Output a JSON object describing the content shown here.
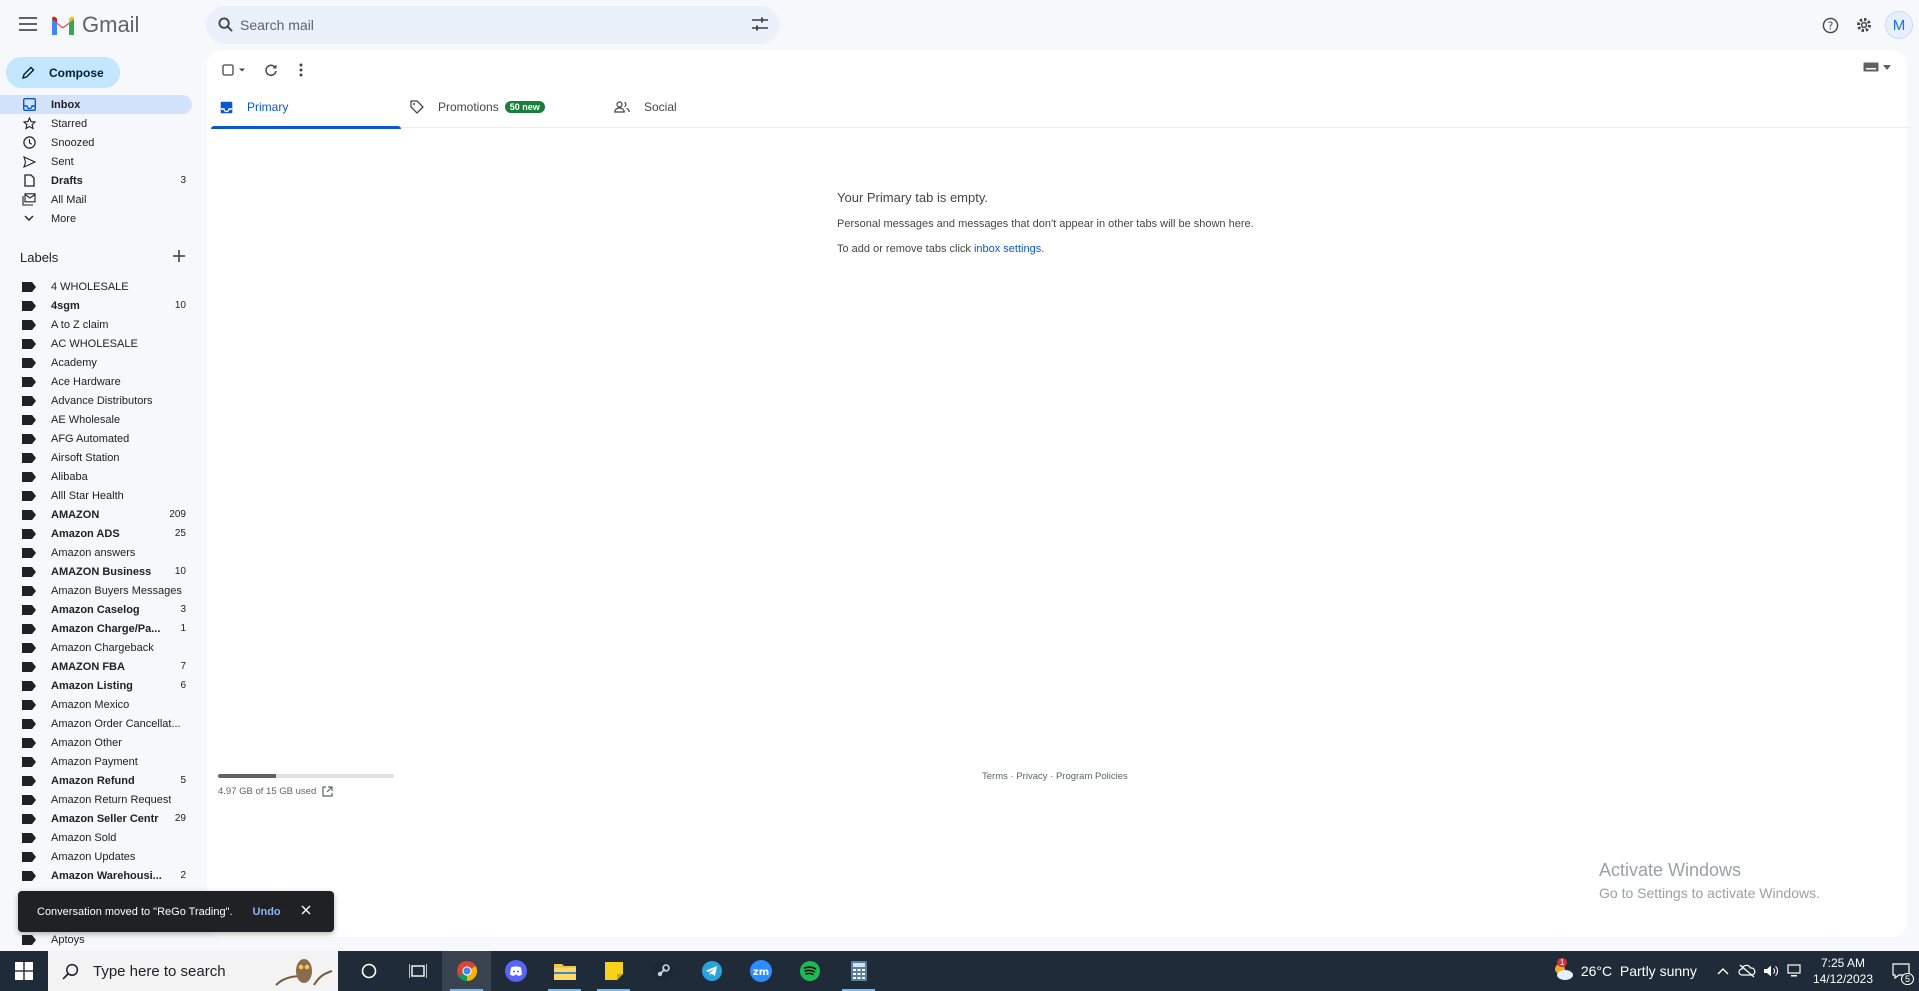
{
  "app": {
    "name": "Gmail"
  },
  "search": {
    "placeholder": "Search mail"
  },
  "header": {
    "avatar_initial": "M"
  },
  "compose_label": "Compose",
  "nav": [
    {
      "label": "Inbox",
      "icon": "inbox-icon",
      "count": "",
      "active": true,
      "bold": true
    },
    {
      "label": "Starred",
      "icon": "star-icon",
      "count": ""
    },
    {
      "label": "Snoozed",
      "icon": "clock-icon",
      "count": ""
    },
    {
      "label": "Sent",
      "icon": "send-icon",
      "count": ""
    },
    {
      "label": "Drafts",
      "icon": "draft-icon",
      "count": "3",
      "bold": true
    },
    {
      "label": "All Mail",
      "icon": "all-mail-icon",
      "count": ""
    },
    {
      "label": "More",
      "icon": "chevron-down-icon",
      "count": ""
    }
  ],
  "labels_title": "Labels",
  "labels": [
    {
      "name": "4 WHOLESALE",
      "count": ""
    },
    {
      "name": "4sgm",
      "count": "10",
      "bold": true
    },
    {
      "name": "A to Z claim",
      "count": ""
    },
    {
      "name": "AC WHOLESALE",
      "count": ""
    },
    {
      "name": "Academy",
      "count": ""
    },
    {
      "name": "Ace Hardware",
      "count": ""
    },
    {
      "name": "Advance Distributors",
      "count": ""
    },
    {
      "name": "AE Wholesale",
      "count": ""
    },
    {
      "name": "AFG Automated",
      "count": ""
    },
    {
      "name": "Airsoft Station",
      "count": ""
    },
    {
      "name": "Alibaba",
      "count": ""
    },
    {
      "name": "Alll Star Health",
      "count": ""
    },
    {
      "name": "AMAZON",
      "count": "209",
      "bold": true
    },
    {
      "name": "Amazon ADS",
      "count": "25",
      "bold": true
    },
    {
      "name": "Amazon answers",
      "count": ""
    },
    {
      "name": "AMAZON Business",
      "count": "10",
      "bold": true
    },
    {
      "name": "Amazon Buyers Messages",
      "count": ""
    },
    {
      "name": "Amazon Caselog",
      "count": "3",
      "bold": true
    },
    {
      "name": "Amazon Charge/Pa...",
      "count": "1",
      "bold": true
    },
    {
      "name": "Amazon Chargeback",
      "count": ""
    },
    {
      "name": "AMAZON FBA",
      "count": "7",
      "bold": true
    },
    {
      "name": "Amazon Listing",
      "count": "6",
      "bold": true
    },
    {
      "name": "Amazon Mexico",
      "count": ""
    },
    {
      "name": "Amazon Order Cancellat...",
      "count": ""
    },
    {
      "name": "Amazon Other",
      "count": ""
    },
    {
      "name": "Amazon Payment",
      "count": ""
    },
    {
      "name": "Amazon Refund",
      "count": "5",
      "bold": true
    },
    {
      "name": "Amazon Return Request",
      "count": ""
    },
    {
      "name": "Amazon Seller Centr",
      "count": "29",
      "bold": true
    },
    {
      "name": "Amazon Sold",
      "count": ""
    },
    {
      "name": "Amazon Updates",
      "count": ""
    },
    {
      "name": "Amazon Warehousi...",
      "count": "2",
      "bold": true
    }
  ],
  "label_tail": "Aptoys",
  "tabs": [
    {
      "label": "Primary",
      "icon": "inbox-icon",
      "active": true
    },
    {
      "label": "Promotions",
      "icon": "tag-icon",
      "badge": "50 new"
    },
    {
      "label": "Social",
      "icon": "people-icon"
    }
  ],
  "empty": {
    "title": "Your Primary tab is empty.",
    "line1": "Personal messages and messages that don't appear in other tabs will be shown here.",
    "line2_prefix": "To add or remove tabs click ",
    "line2_link": "inbox settings",
    "line2_suffix": "."
  },
  "storage": {
    "text": "4.97 GB of 15 GB used",
    "used_fraction": 0.33
  },
  "footer": {
    "terms": "Terms",
    "privacy": "Privacy",
    "policies": "Program Policies",
    "sep": " · "
  },
  "snackbar": {
    "message": "Conversation moved to \"ReGo Trading\".",
    "undo": "Undo"
  },
  "activate": {
    "title": "Activate Windows",
    "subtitle": "Go to Settings to activate Windows."
  },
  "taskbar": {
    "search_placeholder": "Type here to search",
    "weather": "26°C  Partly sunny",
    "weather_badge": "1",
    "time": "7:25 AM",
    "date": "14/12/2023",
    "notif_count": "5"
  },
  "colors": {
    "accent": "#0b57d0",
    "compose_bg": "#c2e7ff",
    "promo_badge": "#188038",
    "taskbar": "#1f2b38"
  }
}
